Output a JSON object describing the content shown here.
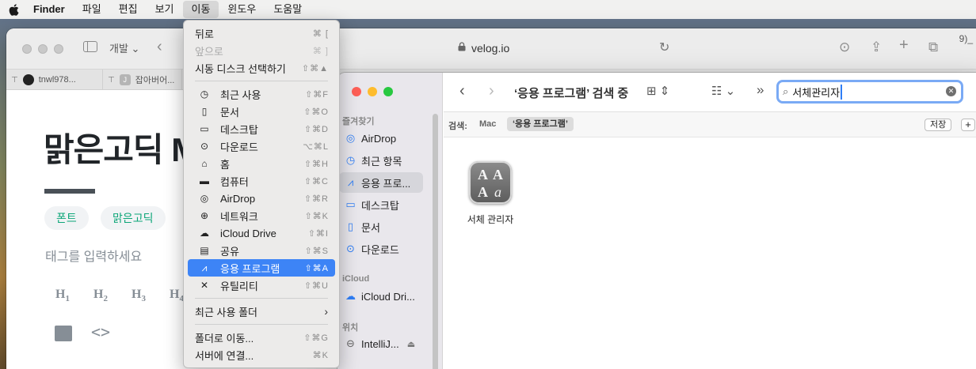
{
  "menubar": {
    "app": "Finder",
    "items": [
      "파일",
      "편집",
      "보기",
      "이동",
      "윈도우",
      "도움말"
    ],
    "active": "이동"
  },
  "browser": {
    "tab_group": "개발",
    "address": "velog.io",
    "tabs": [
      "tnwl978...",
      "잡아버어..."
    ],
    "far_right_text": "9)_",
    "post_title": "맑은고딕 M",
    "tags": [
      "폰트",
      "맑은고딕"
    ],
    "tag_placeholder": "태그를 입력하세요",
    "heading_buttons": [
      "H",
      "H",
      "H",
      "H"
    ],
    "heading_subs": [
      "1",
      "2",
      "3",
      "4"
    ]
  },
  "go_menu": {
    "back": {
      "label": "뒤로",
      "shortcut": "⌘ ["
    },
    "forward": {
      "label": "앞으로",
      "shortcut": "⌘ ]"
    },
    "startup": {
      "label": "시동 디스크 선택하기",
      "shortcut": "⇧⌘▲"
    },
    "places": [
      {
        "icon": "clock-icon",
        "glyph": "◷",
        "label": "최근 사용",
        "shortcut": "⇧⌘F"
      },
      {
        "icon": "document-icon",
        "glyph": "▯",
        "label": "문서",
        "shortcut": "⇧⌘O"
      },
      {
        "icon": "desktop-icon",
        "glyph": "▭",
        "label": "데스크탑",
        "shortcut": "⇧⌘D"
      },
      {
        "icon": "download-icon",
        "glyph": "⊙",
        "label": "다운로드",
        "shortcut": "⌥⌘L"
      },
      {
        "icon": "home-icon",
        "glyph": "⌂",
        "label": "홈",
        "shortcut": "⇧⌘H"
      },
      {
        "icon": "computer-icon",
        "glyph": "▬",
        "label": "컴퓨터",
        "shortcut": "⇧⌘C"
      },
      {
        "icon": "airdrop-icon",
        "glyph": "◎",
        "label": "AirDrop",
        "shortcut": "⇧⌘R"
      },
      {
        "icon": "network-icon",
        "glyph": "⊕",
        "label": "네트워크",
        "shortcut": "⇧⌘K"
      },
      {
        "icon": "cloud-icon",
        "glyph": "☁",
        "label": "iCloud Drive",
        "shortcut": "⇧⌘I"
      },
      {
        "icon": "shared-folder-icon",
        "glyph": "▤",
        "label": "공유",
        "shortcut": "⇧⌘S"
      },
      {
        "icon": "applications-icon",
        "glyph": "⩘",
        "label": "응용 프로그램",
        "shortcut": "⇧⌘A"
      },
      {
        "icon": "utilities-icon",
        "glyph": "✕",
        "label": "유틸리티",
        "shortcut": "⇧⌘U"
      }
    ],
    "recent_folders": {
      "label": "최근 사용 폴더"
    },
    "goto_folder": {
      "label": "폴더로 이동...",
      "shortcut": "⇧⌘G"
    },
    "connect_server": {
      "label": "서버에 연결...",
      "shortcut": "⌘K"
    }
  },
  "finder": {
    "sidebar": {
      "favorites_label": "즐겨찾기",
      "favorites": [
        {
          "icon": "airdrop-icon",
          "glyph": "◎",
          "label": "AirDrop"
        },
        {
          "icon": "clock-icon",
          "glyph": "◷",
          "label": "최근 항목"
        },
        {
          "icon": "applications-icon",
          "glyph": "⩘",
          "label": "응용 프로..."
        },
        {
          "icon": "desktop-icon",
          "glyph": "▭",
          "label": "데스크탑"
        },
        {
          "icon": "document-icon",
          "glyph": "▯",
          "label": "문서"
        },
        {
          "icon": "download-icon",
          "glyph": "⊙",
          "label": "다운로드"
        }
      ],
      "icloud_label": "iCloud",
      "icloud": [
        {
          "icon": "cloud-icon",
          "glyph": "☁",
          "label": "iCloud Dri..."
        }
      ],
      "locations_label": "위치",
      "locations": [
        {
          "icon": "disk-icon",
          "glyph": "⊖",
          "label": "IntelliJ..."
        }
      ]
    },
    "title": "‘응용 프로그램’ 검색 중",
    "search_value": "서체관리자",
    "scope_label": "검색:",
    "scope_options": [
      "Mac",
      "‘응용 프로그램’"
    ],
    "save_label": "저장",
    "plus_label": "+",
    "results": [
      {
        "name": "서체 관리자",
        "glyphs": [
          "A",
          "A",
          "A",
          "a"
        ]
      }
    ]
  },
  "colors": {
    "menu_highlight": "#3d84f6",
    "tag_text": "#0ca678",
    "search_focus": "#7aaaf5"
  }
}
